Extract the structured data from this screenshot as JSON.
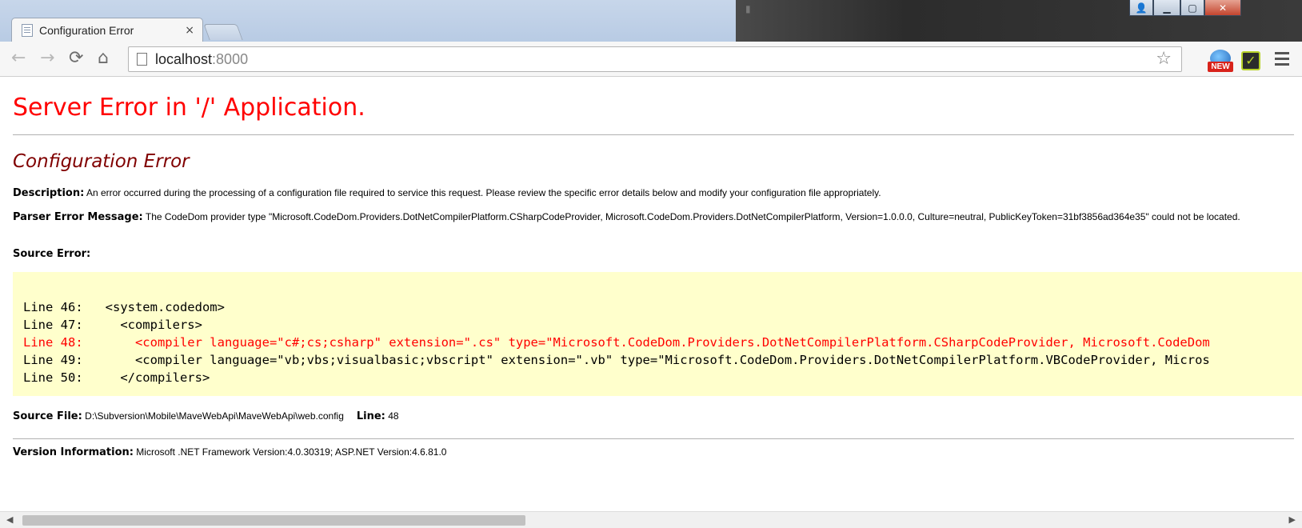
{
  "browser": {
    "tab_title": "Configuration Error",
    "tab_close": "×",
    "url_host": "localhost",
    "url_port": ":8000",
    "back": "←",
    "forward": "→",
    "reload": "⟳",
    "home": "⌂",
    "star": "☆",
    "ext_badge": "NEW",
    "window_controls": {
      "user": "👤",
      "minimize": "▁",
      "maximize": "▢",
      "close": "✕"
    },
    "icons": [
      "page-icon",
      "back-arrow-icon",
      "forward-arrow-icon",
      "reload-icon",
      "home-icon",
      "star-icon",
      "extension-new-icon",
      "extension-check-icon",
      "menu-icon"
    ]
  },
  "page": {
    "title": "Server Error in '/' Application.",
    "subtitle": "Configuration Error",
    "description_label": "Description:",
    "description_text": " An error occurred during the processing of a configuration file required to service this request. Please review the specific error details below and modify your configuration file appropriately.",
    "parser_label": "Parser Error Message:",
    "parser_text": " The CodeDom provider type \"Microsoft.CodeDom.Providers.DotNetCompilerPlatform.CSharpCodeProvider, Microsoft.CodeDom.Providers.DotNetCompilerPlatform, Version=1.0.0.0, Culture=neutral, PublicKeyToken=31bf3856ad364e35\" could not be located.",
    "source_error_label": "Source Error:",
    "code_lines": [
      {
        "text": "Line 46:   <system.codedom>",
        "highlight": false
      },
      {
        "text": "Line 47:     <compilers>",
        "highlight": false
      },
      {
        "text": "Line 48:       <compiler language=\"c#;cs;csharp\" extension=\".cs\" type=\"Microsoft.CodeDom.Providers.DotNetCompilerPlatform.CSharpCodeProvider, Microsoft.CodeDom",
        "highlight": true
      },
      {
        "text": "Line 49:       <compiler language=\"vb;vbs;visualbasic;vbscript\" extension=\".vb\" type=\"Microsoft.CodeDom.Providers.DotNetCompilerPlatform.VBCodeProvider, Micros",
        "highlight": false
      },
      {
        "text": "Line 50:     </compilers>",
        "highlight": false
      }
    ],
    "source_file_label": "Source File:",
    "source_file_value": " D:\\Subversion\\Mobile\\MaveWebApi\\MaveWebApi\\web.config",
    "line_label": "Line:",
    "line_value": " 48",
    "version_label": "Version Information:",
    "version_text": " Microsoft .NET Framework Version:4.0.30319; ASP.NET Version:4.6.81.0"
  },
  "scrollbar": {
    "left_arrow": "◀",
    "right_arrow": "▶",
    "thumb_fraction": 0.4
  },
  "colors": {
    "title": "#ff0000",
    "subtitle": "#800000",
    "code_bg": "#ffffcc",
    "code_highlight": "#ff0000"
  }
}
